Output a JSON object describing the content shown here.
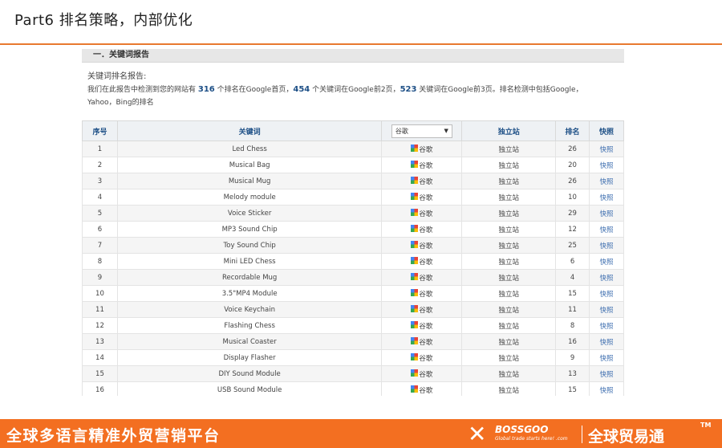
{
  "slide": {
    "title": "Part6   排名策略，内部优化"
  },
  "section": {
    "header": "一．关键词报告"
  },
  "report": {
    "heading": "关键词排名报告:",
    "line1_a": "我们在此报告中检测到您的网站有 ",
    "count_page1": "316",
    "line1_b": " 个排名在Google首页，",
    "count_page2": "454",
    "line1_c": " 个关键词在Google前2页，",
    "count_page3": "523",
    "line1_d": " 关键词在Google前3页。排名检测中包括Google，",
    "line2": "Yahoo，Bing的排名"
  },
  "table": {
    "headers": {
      "index": "序号",
      "keyword": "关键词",
      "engine_select": "谷歌",
      "site": "独立站",
      "rank": "排名",
      "snapshot": "快照"
    },
    "rows": [
      {
        "index": "1",
        "keyword": "Led Chess",
        "engine": "谷歌",
        "site": "独立站",
        "rank": "26",
        "snapshot": "快照"
      },
      {
        "index": "2",
        "keyword": "Musical Bag",
        "engine": "谷歌",
        "site": "独立站",
        "rank": "20",
        "snapshot": "快照"
      },
      {
        "index": "3",
        "keyword": "Musical Mug",
        "engine": "谷歌",
        "site": "独立站",
        "rank": "26",
        "snapshot": "快照"
      },
      {
        "index": "4",
        "keyword": "Melody module",
        "engine": "谷歌",
        "site": "独立站",
        "rank": "10",
        "snapshot": "快照"
      },
      {
        "index": "5",
        "keyword": "Voice Sticker",
        "engine": "谷歌",
        "site": "独立站",
        "rank": "29",
        "snapshot": "快照"
      },
      {
        "index": "6",
        "keyword": "MP3 Sound Chip",
        "engine": "谷歌",
        "site": "独立站",
        "rank": "12",
        "snapshot": "快照"
      },
      {
        "index": "7",
        "keyword": "Toy Sound Chip",
        "engine": "谷歌",
        "site": "独立站",
        "rank": "25",
        "snapshot": "快照"
      },
      {
        "index": "8",
        "keyword": "Mini LED Chess",
        "engine": "谷歌",
        "site": "独立站",
        "rank": "6",
        "snapshot": "快照"
      },
      {
        "index": "9",
        "keyword": "Recordable Mug",
        "engine": "谷歌",
        "site": "独立站",
        "rank": "4",
        "snapshot": "快照"
      },
      {
        "index": "10",
        "keyword": "3.5\"MP4 Module",
        "engine": "谷歌",
        "site": "独立站",
        "rank": "15",
        "snapshot": "快照"
      },
      {
        "index": "11",
        "keyword": "Voice Keychain",
        "engine": "谷歌",
        "site": "独立站",
        "rank": "11",
        "snapshot": "快照"
      },
      {
        "index": "12",
        "keyword": "Flashing Chess",
        "engine": "谷歌",
        "site": "独立站",
        "rank": "8",
        "snapshot": "快照"
      },
      {
        "index": "13",
        "keyword": "Musical Coaster",
        "engine": "谷歌",
        "site": "独立站",
        "rank": "16",
        "snapshot": "快照"
      },
      {
        "index": "14",
        "keyword": "Display Flasher",
        "engine": "谷歌",
        "site": "独立站",
        "rank": "9",
        "snapshot": "快照"
      },
      {
        "index": "15",
        "keyword": "DIY Sound Module",
        "engine": "谷歌",
        "site": "独立站",
        "rank": "13",
        "snapshot": "快照"
      },
      {
        "index": "16",
        "keyword": "USB Sound Module",
        "engine": "谷歌",
        "site": "独立站",
        "rank": "15",
        "snapshot": "快照"
      }
    ]
  },
  "footer": {
    "slogan": "全球多语言精准外贸营销平台",
    "brand_name": "BOSSGOO",
    "brand_tagline": "Global trade starts here! .com",
    "brand_cn": "全球贸易通",
    "trademark": "TM"
  },
  "colors": {
    "accent_orange": "#f36f21",
    "header_blue": "#1d4f86",
    "link_blue": "#3f6fb0"
  },
  "icons": {
    "engine": "google-logo-icon",
    "dropdown": "caret-down-icon",
    "brand": "bossgoo-x-logo-icon"
  }
}
